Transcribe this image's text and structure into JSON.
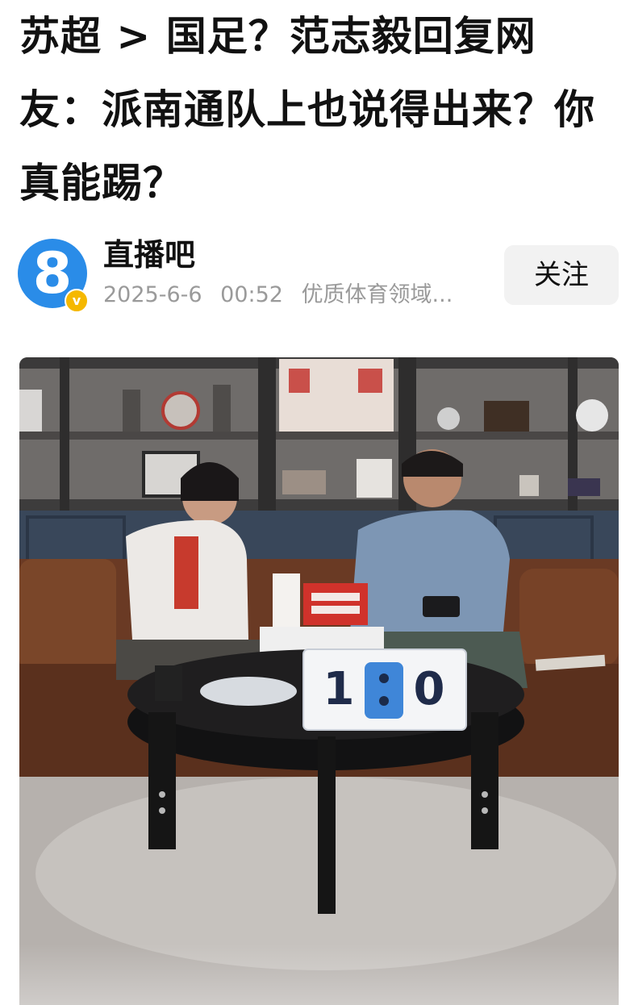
{
  "article": {
    "title": "苏超 > 国足？范志毅回复网友：派南通队上也说得出来？你真能踢？"
  },
  "author": {
    "name": "直播吧",
    "avatar_glyph": "8",
    "avatar_icon": "zhibo8-logo-icon",
    "verified_badge": "v",
    "date": "2025-6-6",
    "time": "00:52",
    "tag": "优质体育领域..."
  },
  "actions": {
    "follow_label": "关注"
  },
  "media": {
    "description_icon": "video-frame-image",
    "scoreboard": {
      "left_digit": "1",
      "right_digit": "0"
    }
  },
  "colors": {
    "avatar_bg": "#2a8ce8",
    "badge": "#f5b800",
    "follow_bg": "#f2f2f2",
    "meta_text": "#9a9a9a"
  }
}
